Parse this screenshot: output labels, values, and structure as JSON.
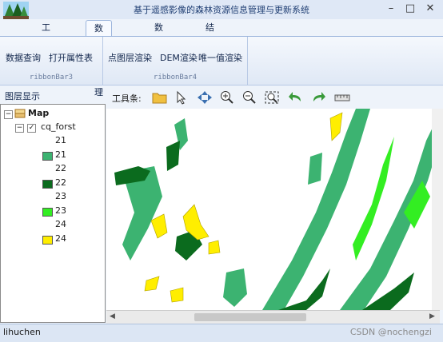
{
  "window": {
    "title": "基于遥感影像的森林资源信息管理与更新系统",
    "min": "–",
    "max": "□",
    "close": "✕"
  },
  "tabs": [
    "工程管理",
    "数据预处理",
    "数据分析",
    "结果输出"
  ],
  "active_tab": 1,
  "ribbon": {
    "group3": {
      "caption": "ribbonBar3",
      "buttons": [
        "数据查询",
        "打开属性表"
      ]
    },
    "group4": {
      "caption": "ribbonBar4",
      "buttons": [
        "点图层渲染",
        "DEM渲染",
        "唯一值渲染"
      ]
    }
  },
  "layer_panel": {
    "title": "图层显示"
  },
  "toolbar": {
    "label": "工具条:",
    "tools": [
      "open-folder-icon",
      "select-arrow-icon",
      "pan-icon",
      "zoom-in-icon",
      "zoom-out-icon",
      "full-extent-icon",
      "back-icon",
      "forward-icon",
      "measure-icon"
    ]
  },
  "toc": {
    "map_label": "Map",
    "layer_label": "cq_forst",
    "legend": [
      {
        "label": "21",
        "color": null
      },
      {
        "label": "21",
        "color": "#3cb371"
      },
      {
        "label": "22",
        "color": null
      },
      {
        "label": "22",
        "color": "#0b6b1e"
      },
      {
        "label": "23",
        "color": null
      },
      {
        "label": "23",
        "color": "#33ee22"
      },
      {
        "label": "24",
        "color": null
      },
      {
        "label": "24",
        "color": "#ffee00"
      }
    ]
  },
  "status": {
    "user": "lihuchen",
    "watermark": "CSDN @nochengzi"
  },
  "colors": {
    "c21": "#3cb371",
    "c22": "#0b6b1e",
    "c23": "#33ee22",
    "c24": "#ffee00",
    "accent": "#1f3e73"
  }
}
